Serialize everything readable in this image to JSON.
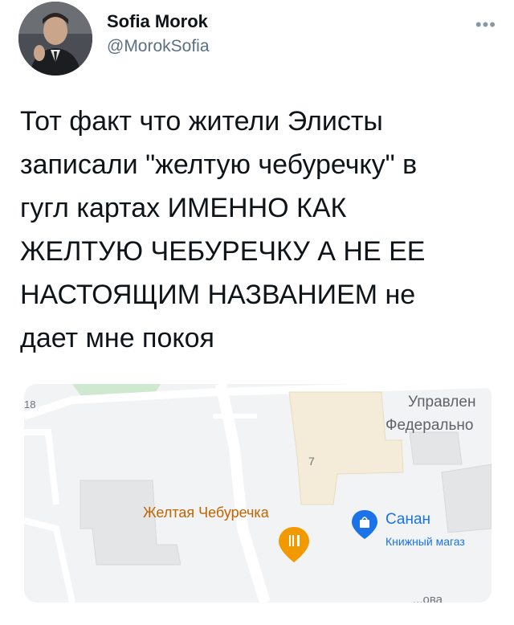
{
  "author": {
    "name": "Sofia Morok",
    "handle": "@MorokSofia"
  },
  "more_icon": "more-horizontal-icon",
  "tweet_text": "Тот факт что жители Элисты\nзаписали \"желтую чебуречку\" в\nгугл картах ИМЕННО КАК\nЖЕЛТУЮ ЧЕБУРЕЧКУ А НЕ ЕЕ\nНАСТОЯЩИМ НАЗВАНИЕМ не\nдает мне покоя",
  "map": {
    "label_18": "18",
    "label_7": "7",
    "label_upravlenie": "Управлен",
    "label_federalno": "Федерально",
    "label_cheburechka": "Желтая Чебуречка",
    "label_sanan": "Санан",
    "label_bookstore": "Книжный магаз",
    "label_street": "...ова",
    "restaurant_pin_icon": "restaurant-pin-icon",
    "shopping_pin_icon": "shopping-bag-pin-icon",
    "colors": {
      "restaurant": "#f29900",
      "shop": "#1a73e8",
      "bg": "#f1f3f4",
      "building": "#e4e6e8"
    }
  }
}
